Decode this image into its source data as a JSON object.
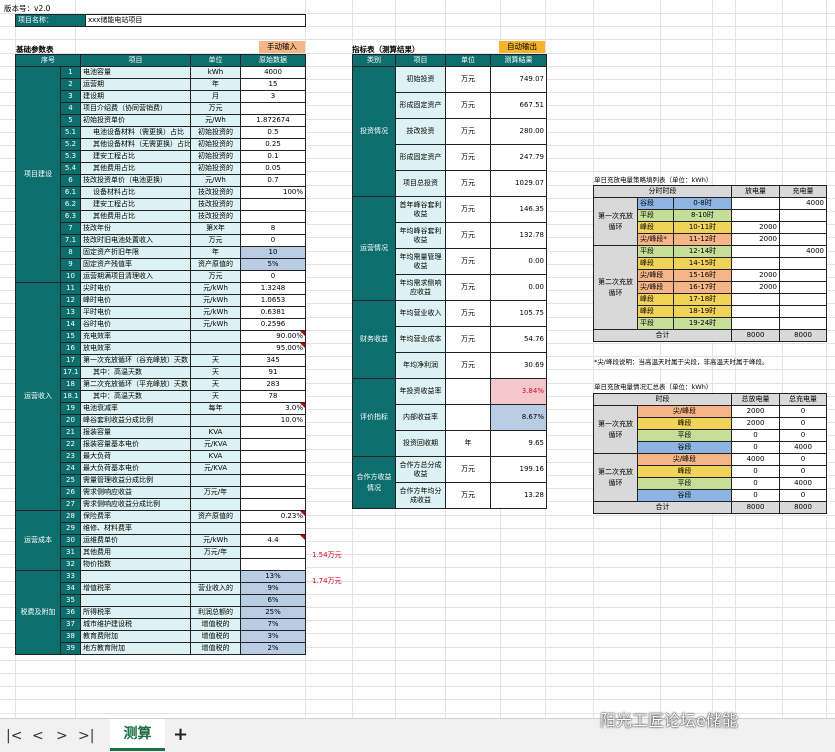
{
  "version": "版本号：v2.0",
  "project": {
    "label": "项目名称：",
    "value": "xxx储能电站项目"
  },
  "basic": {
    "title": "基础参数表",
    "badge": "手动输入",
    "headers": [
      "序号",
      "项目",
      "单位",
      "原始数据"
    ],
    "groups": [
      {
        "name": "项目建设",
        "rows": [
          [
            "1",
            "电池容量",
            "kWh",
            "4000",
            "",
            ""
          ],
          [
            "2",
            "运营期",
            "年",
            "15",
            "",
            ""
          ],
          [
            "3",
            "建设期",
            "月",
            "3",
            "",
            ""
          ],
          [
            "4",
            "项目介绍费（协同营销费）",
            "万元",
            "",
            "",
            ""
          ],
          [
            "5",
            "初始投资单价",
            "元/Wh",
            "1.872674",
            "",
            ""
          ],
          [
            "5.1",
            "电池设备材料（需更换）占比",
            "初始投资的",
            "0.5",
            "sub",
            ""
          ],
          [
            "5.2",
            "其他设备材料（无需更换）占比",
            "初始投资的",
            "0.25",
            "sub",
            ""
          ],
          [
            "5.3",
            "建安工程占比",
            "初始投资的",
            "0.1",
            "sub",
            ""
          ],
          [
            "5.4",
            "其他费用占比",
            "初始投资的",
            "0.05",
            "sub",
            ""
          ],
          [
            "6",
            "技改投资单价（电池更换）",
            "元/Wh",
            "0.7",
            "",
            ""
          ],
          [
            "6.1",
            "设备材料占比",
            "技改投资的",
            "100%",
            "sub",
            ""
          ],
          [
            "6.2",
            "建安工程占比",
            "技改投资的",
            "",
            "sub",
            ""
          ],
          [
            "6.3",
            "其他费用占比",
            "技改投资的",
            "",
            "sub",
            ""
          ],
          [
            "7",
            "技改年份",
            "第X年",
            "8",
            "",
            ""
          ],
          [
            "7.1",
            "技改时旧电池处置收入",
            "万元",
            "0",
            "",
            ""
          ],
          [
            "8",
            "固定资产折旧年限",
            "年",
            "10",
            "",
            "b"
          ],
          [
            "9",
            "固定资产残值率",
            "资产原值的",
            "5%",
            "",
            "b"
          ],
          [
            "10",
            "运营期满项目清理收入",
            "万元",
            "0",
            "",
            ""
          ]
        ]
      },
      {
        "name": "运营收入",
        "rows": [
          [
            "11",
            "尖时电价",
            "元/kWh",
            "1.3248",
            "",
            ""
          ],
          [
            "12",
            "峰时电价",
            "元/kWh",
            "1.0653",
            "",
            ""
          ],
          [
            "13",
            "平时电价",
            "元/kWh",
            "0.6381",
            "",
            ""
          ],
          [
            "14",
            "谷时电价",
            "元/kWh",
            "0.2596",
            "",
            ""
          ],
          [
            "15",
            "充电效率",
            "",
            "90.00%",
            "",
            "t"
          ],
          [
            "16",
            "放电效率",
            "",
            "95.00%",
            "",
            "t"
          ],
          [
            "17",
            "第一次充放循环（谷充峰放）天数",
            "天",
            "345",
            "",
            ""
          ],
          [
            "17.1",
            "其中：高温天数",
            "天",
            "91",
            "sub",
            ""
          ],
          [
            "18",
            "第二次充放循环（平充峰放）天数",
            "天",
            "283",
            "",
            ""
          ],
          [
            "18.1",
            "其中：高温天数",
            "天",
            "78",
            "sub",
            ""
          ],
          [
            "19",
            "电池衰减率",
            "每年",
            "3.0%",
            "",
            "t"
          ],
          [
            "20",
            "峰谷套利收益分成比例",
            "",
            "10.0%",
            "",
            ""
          ],
          [
            "21",
            "报装容量",
            "KVA",
            "",
            "",
            ""
          ],
          [
            "22",
            "报装容量基本电价",
            "元/KVA",
            "",
            "",
            ""
          ],
          [
            "23",
            "最大负荷",
            "KVA",
            "",
            "",
            ""
          ],
          [
            "24",
            "最大负荷基本电价",
            "元/KVA",
            "",
            "",
            ""
          ],
          [
            "25",
            "需量管理收益分成比例",
            "",
            "",
            "",
            ""
          ],
          [
            "26",
            "需求侧响应收益",
            "万元/年",
            "",
            "",
            ""
          ],
          [
            "27",
            "需求侧响应收益分成比例",
            "",
            "",
            "",
            ""
          ]
        ]
      },
      {
        "name": "运营成本",
        "rows": [
          [
            "28",
            "保险费率",
            "资产原值的",
            "0.23%",
            "",
            "t"
          ],
          [
            "29",
            "维修、材料费率",
            "",
            "",
            "",
            ""
          ],
          [
            "30",
            "运维费单价",
            "元/kWh",
            "4.4",
            "",
            "t"
          ],
          [
            "31",
            "其他费用",
            "万元/年",
            "",
            "",
            ""
          ],
          [
            "32",
            "物价指数",
            "",
            "",
            "",
            ""
          ]
        ]
      },
      {
        "name": "税费及附加",
        "rows": [
          [
            "33",
            "",
            "",
            "13%",
            "",
            "b"
          ],
          [
            "34",
            "增值税率",
            "营业收入的",
            "9%",
            "",
            "b"
          ],
          [
            "35",
            "",
            "",
            "6%",
            "",
            "b"
          ],
          [
            "36",
            "所得税率",
            "利润总额的",
            "25%",
            "",
            "b"
          ],
          [
            "37",
            "城市维护建设税",
            "增值税的",
            "7%",
            "",
            "b"
          ],
          [
            "38",
            "教育费附加",
            "增值税的",
            "3%",
            "",
            "b"
          ],
          [
            "39",
            "地方教育附加",
            "增值税的",
            "2%",
            "",
            "b"
          ]
        ]
      }
    ],
    "side_notes": [
      "1.54万元",
      "1.74万元"
    ]
  },
  "result": {
    "title": "指标表（测算结果）",
    "badge": "自动输出",
    "headers": [
      "类别",
      "项目",
      "单位",
      "测算结果"
    ],
    "groups": [
      {
        "name": "投资情况",
        "rows": [
          [
            "初始投资",
            "万元",
            "749.07",
            ""
          ],
          [
            "形成固定资产",
            "万元",
            "667.51",
            ""
          ],
          [
            "技改投资",
            "万元",
            "280.00",
            ""
          ],
          [
            "形成固定资产",
            "万元",
            "247.79",
            ""
          ],
          [
            "项目总投资",
            "万元",
            "1029.07",
            ""
          ]
        ]
      },
      {
        "name": "运营情况",
        "rows": [
          [
            "首年峰谷套利收益",
            "万元",
            "146.35",
            ""
          ],
          [
            "年均峰谷套利收益",
            "万元",
            "132.78",
            ""
          ],
          [
            "年均需量管理收益",
            "万元",
            "0.00",
            ""
          ],
          [
            "年均需求侧响应收益",
            "万元",
            "0.00",
            ""
          ]
        ]
      },
      {
        "name": "财务收益",
        "rows": [
          [
            "年均营业收入",
            "万元",
            "105.75",
            ""
          ],
          [
            "年均营业成本",
            "万元",
            "54.76",
            ""
          ],
          [
            "年均净利润",
            "万元",
            "30.69",
            ""
          ]
        ]
      },
      {
        "name": "评价指标",
        "rows": [
          [
            "年投资收益率",
            "",
            "3.84%",
            "pink"
          ],
          [
            "内部收益率",
            "",
            "8.67%",
            "blue"
          ],
          [
            "投资回收期",
            "年",
            "9.65",
            ""
          ]
        ]
      },
      {
        "name": "合作方收益情况",
        "rows": [
          [
            "合作方总分成收益",
            "万元",
            "199.16",
            ""
          ],
          [
            "合作方年均分成收益",
            "万元",
            "13.28",
            ""
          ]
        ]
      }
    ]
  },
  "strategy": {
    "title": "单日充放电量策略填列表（单位：kWh）",
    "headers": [
      "分时时段",
      "放电量",
      "充电量"
    ],
    "groups": [
      {
        "name": "第一次充放循环",
        "rows": [
          [
            "谷段",
            "0-8时",
            "",
            "4000",
            "sky"
          ],
          [
            "平段",
            "8-10时",
            "",
            "",
            "green"
          ],
          [
            "峰段",
            "10-11时",
            "2000",
            "",
            "yel"
          ],
          [
            "尖/峰段*",
            "11-12时",
            "2000",
            "",
            "org"
          ]
        ]
      },
      {
        "name": "第二次充放循环",
        "rows": [
          [
            "平段",
            "12-14时",
            "",
            "4000",
            "green"
          ],
          [
            "峰段",
            "14-15时",
            "",
            "",
            "yel"
          ],
          [
            "尖/峰段",
            "15-16时",
            "2000",
            "",
            "org"
          ],
          [
            "尖/峰段",
            "16-17时",
            "2000",
            "",
            "org"
          ],
          [
            "峰段",
            "17-18时",
            "",
            "",
            "yel"
          ],
          [
            "峰段",
            "18-19时",
            "",
            "",
            "yel"
          ],
          [
            "平段",
            "19-24时",
            "",
            "",
            "green"
          ]
        ]
      }
    ],
    "total": [
      "合计",
      "8000",
      "8000"
    ],
    "note": "*尖/峰段说明：当高温天时属于尖段，非高温天时属于峰段。"
  },
  "summary": {
    "title": "单日充放电量情况汇总表（单位：kWh）",
    "headers": [
      "时段",
      "总放电量",
      "总充电量"
    ],
    "groups": [
      {
        "name": "第一次充放循环",
        "rows": [
          [
            "尖/峰段",
            "2000",
            "0",
            "org"
          ],
          [
            "峰段",
            "2000",
            "0",
            "yel"
          ],
          [
            "平段",
            "0",
            "0",
            "green"
          ],
          [
            "谷段",
            "0",
            "4000",
            "sky"
          ]
        ]
      },
      {
        "name": "第二次充放循环",
        "rows": [
          [
            "尖/峰段",
            "4000",
            "0",
            "org"
          ],
          [
            "峰段",
            "0",
            "0",
            "yel"
          ],
          [
            "平段",
            "0",
            "4000",
            "green"
          ],
          [
            "谷段",
            "0",
            "0",
            "sky"
          ]
        ]
      }
    ],
    "total": [
      "合计",
      "8000",
      "8000"
    ]
  },
  "tabs": {
    "sheet": "测算",
    "add": "+",
    "nav": [
      "|<",
      "<",
      ">",
      ">|"
    ]
  },
  "watermark": "阳光工匠论坛e储能"
}
